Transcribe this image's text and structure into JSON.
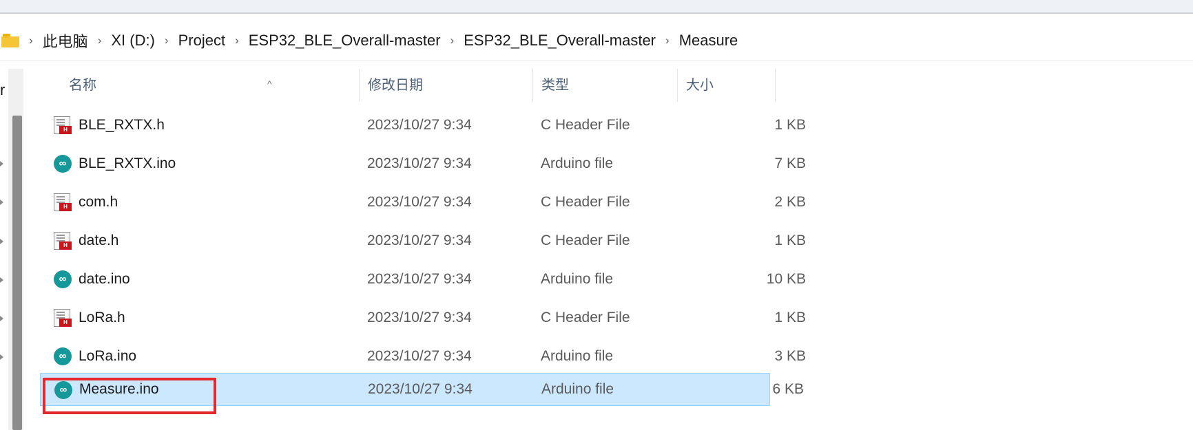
{
  "breadcrumb": [
    "此电脑",
    "XI (D:)",
    "Project",
    "ESP32_BLE_Overall-master",
    "ESP32_BLE_Overall-master",
    "Measure"
  ],
  "sidebar": {
    "partial_label": "r"
  },
  "columns": {
    "name": "名称",
    "date": "修改日期",
    "type": "类型",
    "size": "大小",
    "sort_indicator": "^"
  },
  "files": [
    {
      "name": "BLE_RXTX.h",
      "date": "2023/10/27 9:34",
      "type": "C Header File",
      "size": "1 KB",
      "icon": "c-header-file-icon"
    },
    {
      "name": "BLE_RXTX.ino",
      "date": "2023/10/27 9:34",
      "type": "Arduino file",
      "size": "7 KB",
      "icon": "arduino-file-icon"
    },
    {
      "name": "com.h",
      "date": "2023/10/27 9:34",
      "type": "C Header File",
      "size": "2 KB",
      "icon": "c-header-file-icon"
    },
    {
      "name": "date.h",
      "date": "2023/10/27 9:34",
      "type": "C Header File",
      "size": "1 KB",
      "icon": "c-header-file-icon"
    },
    {
      "name": "date.ino",
      "date": "2023/10/27 9:34",
      "type": "Arduino file",
      "size": "10 KB",
      "icon": "arduino-file-icon"
    },
    {
      "name": "LoRa.h",
      "date": "2023/10/27 9:34",
      "type": "C Header File",
      "size": "1 KB",
      "icon": "c-header-file-icon"
    },
    {
      "name": "LoRa.ino",
      "date": "2023/10/27 9:34",
      "type": "Arduino file",
      "size": "3 KB",
      "icon": "arduino-file-icon"
    },
    {
      "name": "Measure.ino",
      "date": "2023/10/27 9:34",
      "type": "Arduino file",
      "size": "6 KB",
      "icon": "arduino-file-icon"
    }
  ],
  "icons": {
    "header_badge": "H",
    "arduino_glyph": "∞"
  },
  "colors": {
    "selection_bg": "#cce8ff",
    "highlight_border": "#e5282c",
    "arduino_teal": "#16979a",
    "header_red": "#c8161d",
    "folder_yellow": "#f5c538"
  }
}
